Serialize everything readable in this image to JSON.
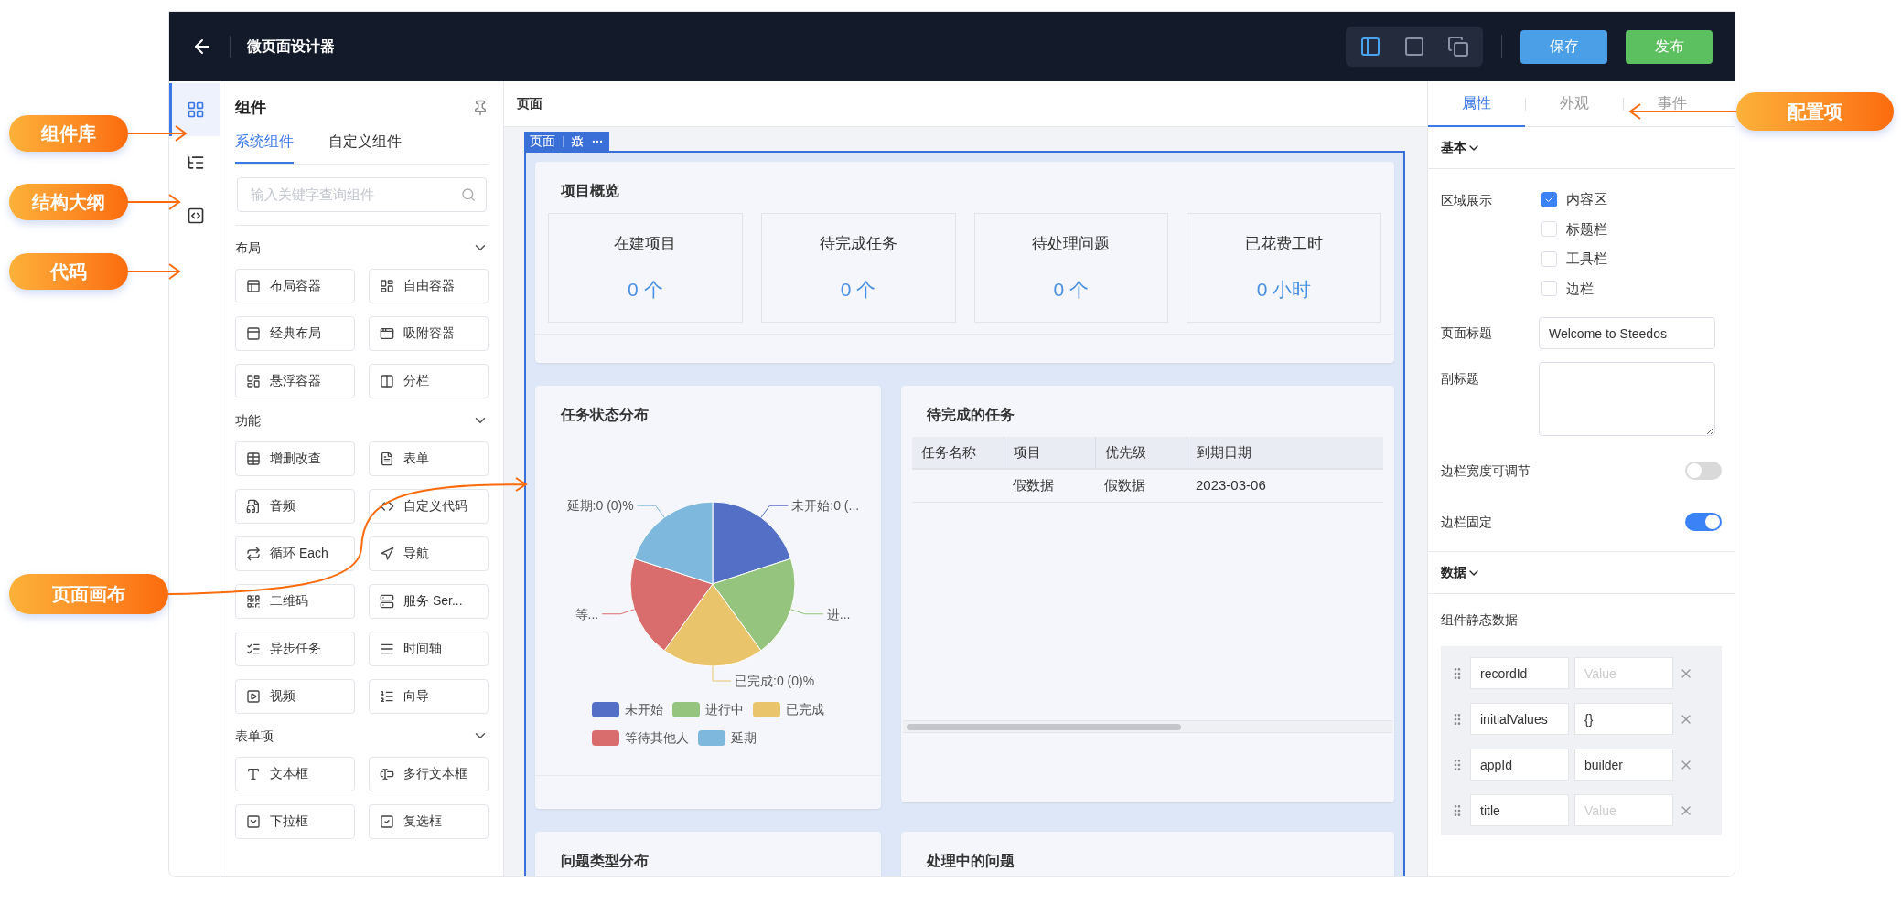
{
  "callouts": [
    {
      "label": "组件库"
    },
    {
      "label": "结构大纲"
    },
    {
      "label": "代码"
    },
    {
      "label": "页面画布"
    },
    {
      "label": "配置项"
    }
  ],
  "topbar": {
    "title": "微页面设计器",
    "view_modes": [
      {
        "selected": true
      },
      {
        "selected": false
      },
      {
        "selected": false
      }
    ],
    "buttons": [
      {
        "label": "保存",
        "kind": "primary"
      },
      {
        "label": "发布",
        "kind": "success"
      }
    ]
  },
  "rail": [
    {
      "selected": true
    },
    {
      "selected": false
    },
    {
      "selected": false
    }
  ],
  "components_panel": {
    "title": "组件",
    "tabs": [
      {
        "label": "系统组件",
        "selected": true
      },
      {
        "label": "自定义组件",
        "selected": false
      }
    ],
    "search": {
      "placeholder": "输入关键字查询组件"
    },
    "sections": [
      {
        "title": "布局",
        "expanded": true,
        "items": [
          "布局容器",
          "自由容器",
          "经典布局",
          "吸附容器",
          "悬浮容器",
          "分栏"
        ]
      },
      {
        "title": "功能",
        "expanded": true,
        "items": [
          "增删改查",
          "表单",
          "音频",
          "自定义代码",
          "循环 Each",
          "导航",
          "二维码",
          "服务 Ser...",
          "异步任务",
          "时间轴",
          "视频",
          "向导"
        ]
      },
      {
        "title": "表单项",
        "expanded": true,
        "items": [
          "文本框",
          "多行文本框",
          "下拉框",
          "复选框"
        ]
      }
    ]
  },
  "canvas": {
    "header": "页面",
    "frame_tag": "页面",
    "overview": {
      "title": "项目概览",
      "stats": [
        {
          "label": "在建项目",
          "value": "0 个"
        },
        {
          "label": "待完成任务",
          "value": "0 个"
        },
        {
          "label": "待处理问题",
          "value": "0 个"
        },
        {
          "label": "已花费工时",
          "value": "0 小时"
        }
      ]
    },
    "task_chart": {
      "title": "任务状态分布",
      "slices": [
        {
          "label": "未开始:0 (...",
          "legend": "未开始",
          "color": "#5470c6"
        },
        {
          "label": "进...",
          "legend": "进行中",
          "color": "#95c47e"
        },
        {
          "label": "已完成:0 (0)%",
          "legend": "已完成",
          "color": "#e9c46a"
        },
        {
          "label": "等...",
          "legend": "等待其他人",
          "color": "#d96c6c"
        },
        {
          "label": "延期:0 (0)%",
          "legend": "延期",
          "color": "#7eb8dc"
        }
      ]
    },
    "tasks": {
      "title": "待完成的任务",
      "columns": [
        "任务名称",
        "项目",
        "优先级",
        "到期日期"
      ],
      "rows": [
        [
          "",
          "假数据",
          "假数据",
          "2023-03-06"
        ]
      ]
    },
    "bottom_cards": [
      "问题类型分布",
      "处理中的问题"
    ]
  },
  "properties": {
    "tabs": [
      {
        "label": "属性",
        "selected": true
      },
      {
        "label": "外观",
        "selected": false
      },
      {
        "label": "事件",
        "selected": false
      }
    ],
    "basic": {
      "title": "基本",
      "expanded": true,
      "area_label": "区域展示",
      "areas": [
        {
          "label": "内容区",
          "checked": true
        },
        {
          "label": "标题栏",
          "checked": false
        },
        {
          "label": "工具栏",
          "checked": false
        },
        {
          "label": "边栏",
          "checked": false
        }
      ],
      "page_title": {
        "label": "页面标题",
        "value": "Welcome to Steedos"
      },
      "subtitle": {
        "label": "副标题"
      },
      "toggles": [
        {
          "label": "边栏宽度可调节",
          "on": false
        },
        {
          "label": "边栏固定",
          "on": true
        }
      ]
    },
    "data": {
      "title": "数据",
      "expanded": true,
      "static_label": "组件静态数据",
      "rows": [
        {
          "key": "recordId",
          "value": "",
          "placeholder": "Value"
        },
        {
          "key": "initialValues",
          "value": "{}"
        },
        {
          "key": "appId",
          "value": "builder"
        },
        {
          "key": "title",
          "value": "",
          "placeholder": "Value"
        }
      ]
    }
  }
}
